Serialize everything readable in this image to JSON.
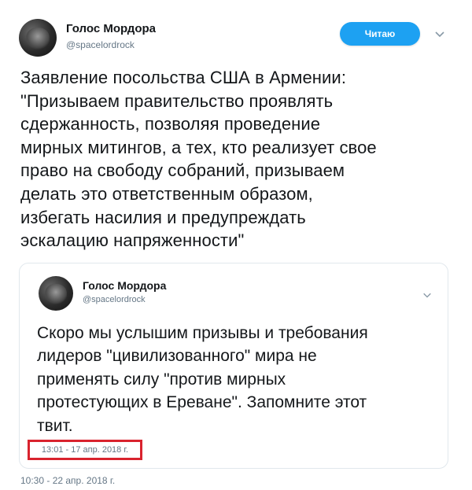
{
  "tweet": {
    "author_name": "Голос Мордора",
    "author_handle": "@spacelordrock",
    "follow_label": "Читаю",
    "text": "Заявление посольства США в Армении:\n\"Призываем правительство проявлять\nсдержанность, позволяя проведение\nмирных митингов, а тех, кто реализует свое\nправо на свободу собраний, призываем\nделать это ответственным образом,\nизбегать насилия и предупреждать\nэскалацию напряженности\"",
    "timestamp": "10:30 - 22 апр. 2018 г.",
    "menu_icon": "chevron-down-icon"
  },
  "quoted_tweet": {
    "author_name": "Голос Мордора",
    "author_handle": "@spacelordrock",
    "text": "Скоро мы услышим призывы и требования\nлидеров \"цивилизованного\" мира не\nприменять силу \"против мирных\nпротестующих в Ереване\". Запомните этот\nтвит.",
    "timestamp": "13:01 - 17 апр. 2018 г.",
    "highlight_color": "#d9232e",
    "menu_icon": "chevron-down-icon"
  },
  "colors": {
    "accent": "#1da1f2",
    "text": "#14171a",
    "muted": "#657786",
    "border": "#e1e8ed"
  }
}
